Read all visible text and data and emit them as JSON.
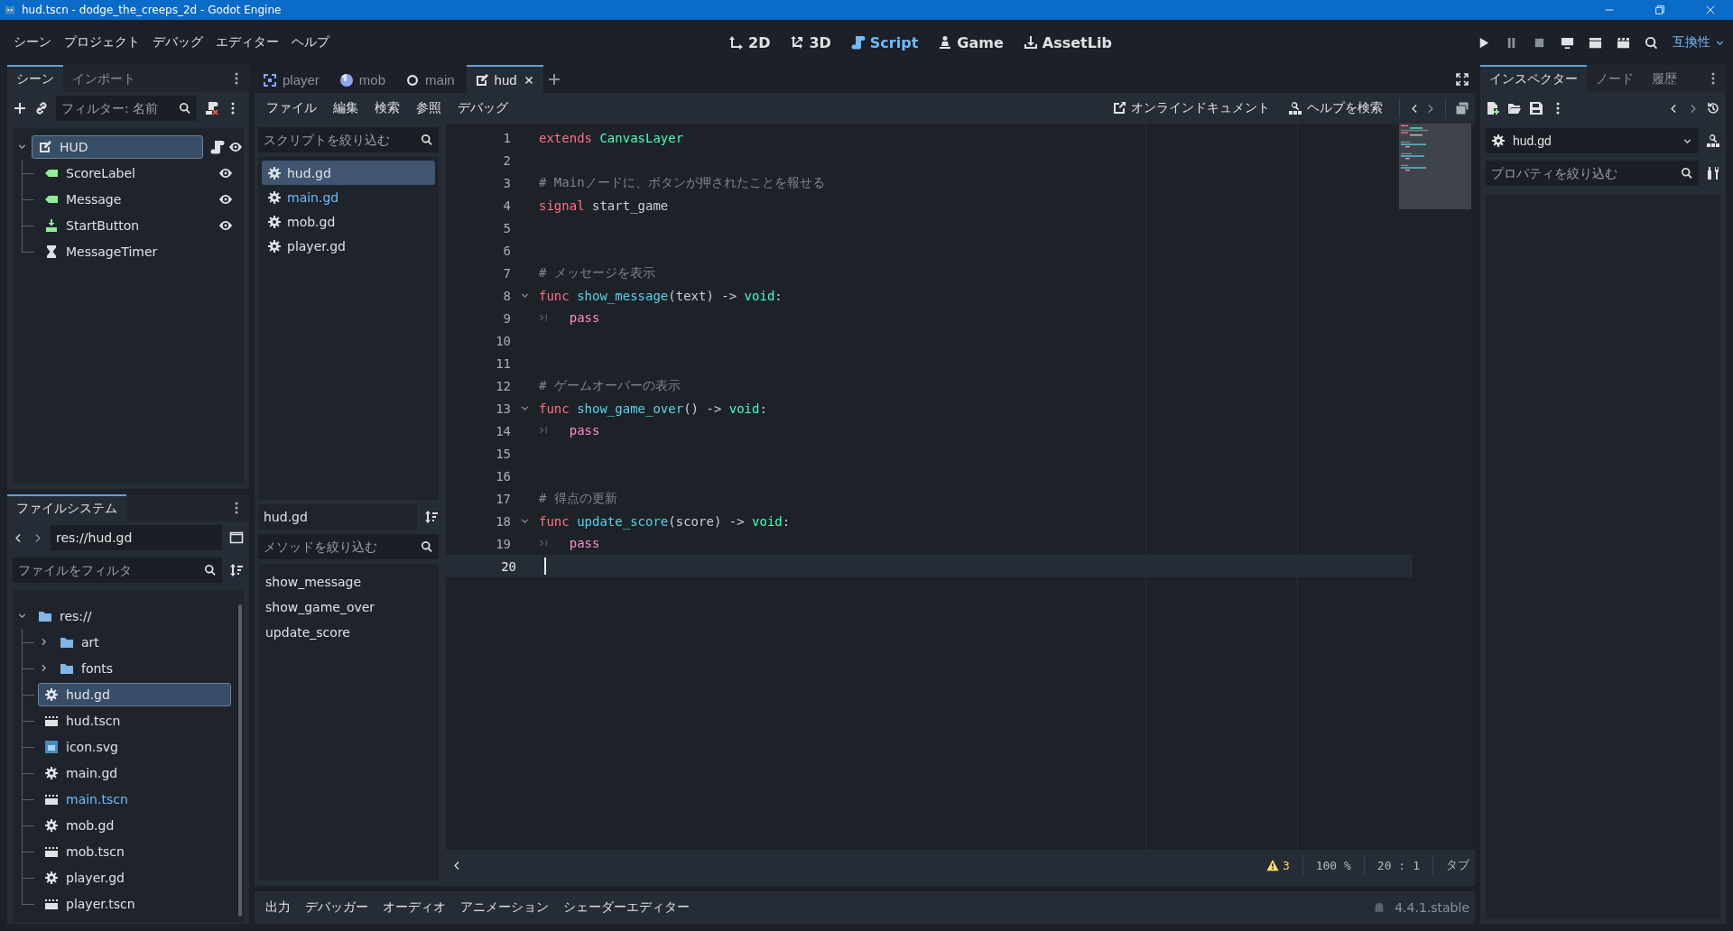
{
  "window": {
    "title": "hud.tscn - dodge_the_creeps_2d - Godot Engine"
  },
  "menu": [
    "シーン",
    "プロジェクト",
    "デバッグ",
    "エディター",
    "ヘルプ"
  ],
  "workspaces": [
    {
      "label": "2D",
      "kind": "planar",
      "selected": false
    },
    {
      "label": "3D",
      "kind": "spatial",
      "selected": false
    },
    {
      "label": "Script",
      "kind": "script",
      "selected": true
    },
    {
      "label": "Game",
      "kind": "game",
      "selected": false
    },
    {
      "label": "AssetLib",
      "kind": "assetlib",
      "selected": false
    }
  ],
  "renderer": "互換性",
  "scene_dock": {
    "tabs": [
      {
        "label": "シーン",
        "selected": true
      },
      {
        "label": "インポート",
        "selected": false
      }
    ],
    "filter": {
      "placeholder": "フィルター: 名前"
    },
    "tree": [
      {
        "label": "HUD",
        "kind": "canvas",
        "selected": true,
        "expanded": true,
        "script": true,
        "eye": true,
        "children": [
          {
            "label": "ScoreLabel",
            "kind": "label",
            "selected": false,
            "eye": true
          },
          {
            "label": "Message",
            "kind": "label",
            "selected": false,
            "eye": true
          },
          {
            "label": "StartButton",
            "kind": "button",
            "selected": false,
            "eye": true
          },
          {
            "label": "MessageTimer",
            "kind": "timer",
            "selected": false,
            "eye": false
          }
        ]
      }
    ]
  },
  "filesystem": {
    "tabs": [
      {
        "label": "ファイルシステム",
        "selected": true
      }
    ],
    "path": {
      "value": "res://hud.gd"
    },
    "filter": {
      "placeholder": "ファイルをフィルタ"
    },
    "tree": [
      {
        "label": "res://",
        "kind": "folder",
        "selected": false,
        "expanded": true,
        "children": [
          {
            "label": "art",
            "kind": "folder",
            "selected": false,
            "expanded": false
          },
          {
            "label": "fonts",
            "kind": "folder",
            "selected": false,
            "expanded": false
          },
          {
            "label": "hud.gd",
            "kind": "script",
            "selected": true
          },
          {
            "label": "hud.tscn",
            "kind": "scene",
            "selected": false
          },
          {
            "label": "icon.svg",
            "kind": "image",
            "selected": false
          },
          {
            "label": "main.gd",
            "kind": "script",
            "selected": false
          },
          {
            "label": "main.tscn",
            "kind": "scene",
            "selected": false,
            "highlight": true
          },
          {
            "label": "mob.gd",
            "kind": "script",
            "selected": false
          },
          {
            "label": "mob.tscn",
            "kind": "scene",
            "selected": false
          },
          {
            "label": "player.gd",
            "kind": "script",
            "selected": false
          },
          {
            "label": "player.tscn",
            "kind": "scene",
            "selected": false
          }
        ]
      }
    ]
  },
  "editor_tabs": [
    {
      "label": "player",
      "kind": "frame",
      "selected": false
    },
    {
      "label": "mob",
      "kind": "ball",
      "selected": false
    },
    {
      "label": "main",
      "kind": "ring",
      "selected": false
    },
    {
      "label": "hud",
      "kind": "canvas",
      "selected": true
    }
  ],
  "script_menu": [
    "ファイル",
    "編集",
    "検索",
    "参照",
    "デバッグ"
  ],
  "script_links": [
    "オンラインドキュメント",
    "ヘルプを検索"
  ],
  "script_list": {
    "filter": {
      "placeholder": "スクリプトを絞り込む"
    },
    "items": [
      {
        "label": "hud.gd",
        "selected": true,
        "highlight": false
      },
      {
        "label": "main.gd",
        "selected": false,
        "highlight": true
      },
      {
        "label": "mob.gd",
        "selected": false,
        "highlight": false
      },
      {
        "label": "player.gd",
        "selected": false,
        "highlight": false
      }
    ]
  },
  "current_script": "hud.gd",
  "method_filter": {
    "placeholder": "メソッドを絞り込む"
  },
  "methods": [
    "show_message",
    "show_game_over",
    "update_score"
  ],
  "code": {
    "lines": [
      {
        "number": "1",
        "tokens": [
          {
            "kind": "keyword",
            "text": "extends "
          },
          {
            "kind": "type",
            "text": "CanvasLayer"
          }
        ]
      },
      {
        "number": "2"
      },
      {
        "number": "3",
        "tokens": [
          {
            "kind": "comment",
            "text": "# Mainノードに、ボタンが押されたことを報せる"
          }
        ]
      },
      {
        "number": "4",
        "tokens": [
          {
            "kind": "keyword",
            "text": "signal"
          },
          {
            "kind": "text",
            "text": " start_game"
          }
        ]
      },
      {
        "number": "5"
      },
      {
        "number": "6"
      },
      {
        "number": "7",
        "tokens": [
          {
            "kind": "comment",
            "text": "# メッセージを表示"
          }
        ]
      },
      {
        "number": "8",
        "foldable": true,
        "tokens": [
          {
            "kind": "keyword",
            "text": "func "
          },
          {
            "kind": "function",
            "text": "show_message"
          },
          {
            "kind": "text",
            "text": "(text) -> "
          },
          {
            "kind": "type",
            "text": "void"
          },
          {
            "kind": "text",
            "text": ":"
          }
        ]
      },
      {
        "number": "9",
        "tokens": [
          {
            "kind": "tab"
          },
          {
            "kind": "control",
            "text": "pass"
          }
        ]
      },
      {
        "number": "10"
      },
      {
        "number": "11"
      },
      {
        "number": "12",
        "tokens": [
          {
            "kind": "comment",
            "text": "# ゲームオーバーの表示"
          }
        ]
      },
      {
        "number": "13",
        "foldable": true,
        "tokens": [
          {
            "kind": "keyword",
            "text": "func "
          },
          {
            "kind": "function",
            "text": "show_game_over"
          },
          {
            "kind": "text",
            "text": "() -> "
          },
          {
            "kind": "type",
            "text": "void"
          },
          {
            "kind": "text",
            "text": ":"
          }
        ]
      },
      {
        "number": "14",
        "tokens": [
          {
            "kind": "tab"
          },
          {
            "kind": "control",
            "text": "pass"
          }
        ]
      },
      {
        "number": "15"
      },
      {
        "number": "16"
      },
      {
        "number": "17",
        "tokens": [
          {
            "kind": "comment",
            "text": "# 得点の更新"
          }
        ]
      },
      {
        "number": "18",
        "foldable": true,
        "tokens": [
          {
            "kind": "keyword",
            "text": "func "
          },
          {
            "kind": "function",
            "text": "update_score"
          },
          {
            "kind": "text",
            "text": "(score) -> "
          },
          {
            "kind": "type",
            "text": "void"
          },
          {
            "kind": "text",
            "text": ":"
          }
        ]
      },
      {
        "number": "19",
        "tokens": [
          {
            "kind": "tab"
          },
          {
            "kind": "control",
            "text": "pass"
          }
        ]
      },
      {
        "number": "20",
        "current": true
      }
    ]
  },
  "status": {
    "warnings": "3",
    "zoom": "100 %",
    "line": "20 :",
    "column": "1",
    "indent": "タブ"
  },
  "bottom_tabs": [
    "出力",
    "デバッガー",
    "オーディオ",
    "アニメーション",
    "シェーダーエディター"
  ],
  "version": "4.4.1.stable",
  "inspector": {
    "tabs": [
      {
        "label": "インスペクター",
        "selected": true
      },
      {
        "label": "ノード",
        "selected": false
      },
      {
        "label": "履歴",
        "selected": false
      }
    ],
    "resource": "hud.gd",
    "filter": {
      "placeholder": "プロパティを絞り込む"
    }
  }
}
